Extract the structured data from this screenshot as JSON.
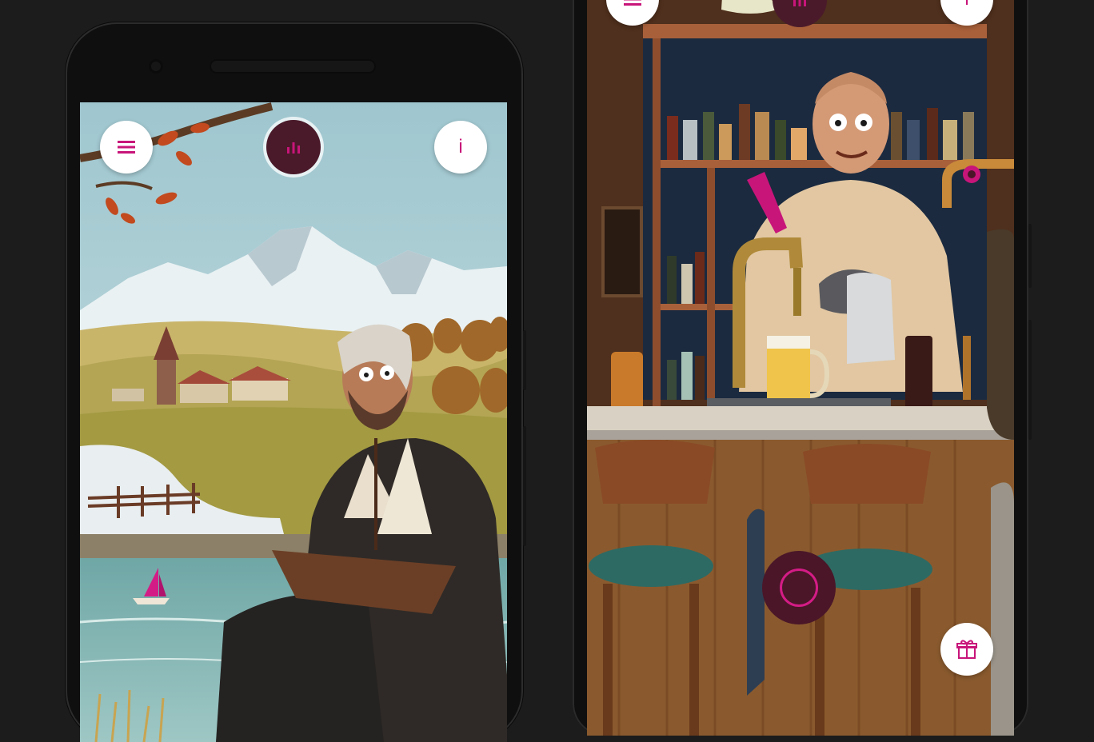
{
  "colors": {
    "accent": "#c8157a",
    "stats_button_bg": "#4a1a2a",
    "background": "#1c1c1c"
  },
  "left_screen": {
    "menu_icon": "hamburger-menu-icon",
    "stats_icon": "bar-chart-icon",
    "info_label": "i"
  },
  "right_screen": {
    "menu_icon": "hamburger-menu-icon",
    "stats_icon": "bar-chart-icon",
    "info_label": "i",
    "record_icon": "record-ring-icon",
    "gift_icon": "gift-box-icon"
  }
}
